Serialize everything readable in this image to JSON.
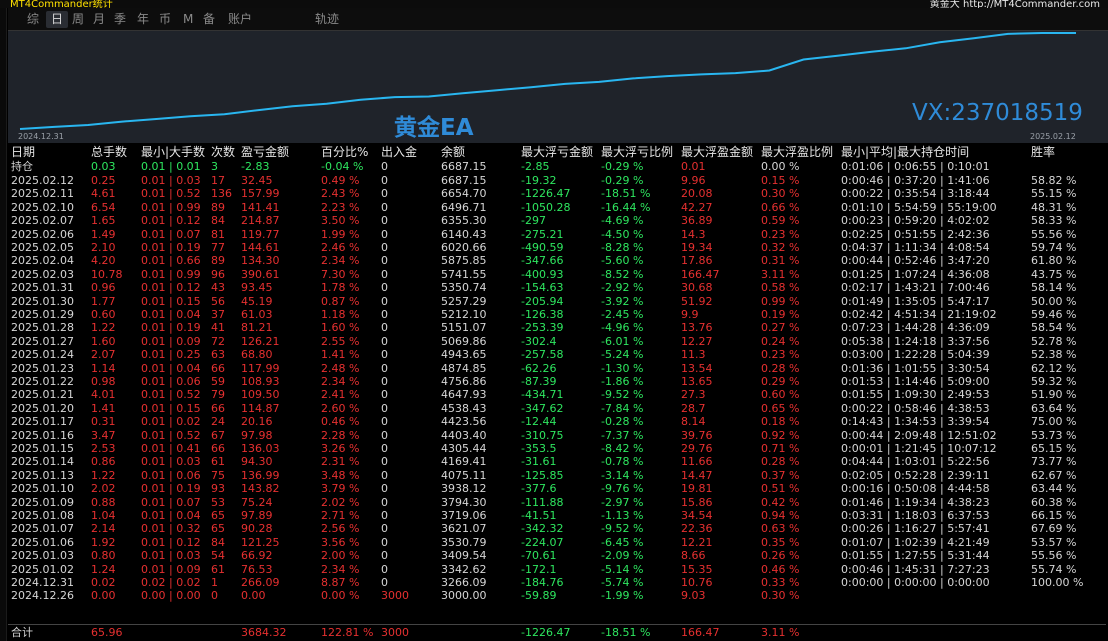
{
  "title_bar": {
    "left": "MT4Commander统计",
    "right": "黄金大 http://MT4Commander.com"
  },
  "tabs": [
    "综",
    "日",
    "周",
    "月",
    "季",
    "年",
    "币",
    "M",
    "备",
    "账户",
    "轨迹"
  ],
  "active_tab": 1,
  "chart": {
    "start_date": "2024.12.31",
    "end_date": "2025.02.12",
    "watermark_left": "黄金EA",
    "watermark_right": "VX:237018519",
    "curve_color": "#29b6f0"
  },
  "columns": [
    "日期",
    "总手数",
    "最小|大手数",
    "次数",
    "盈亏金额",
    "百分比%",
    "出入金",
    "余额",
    "最大浮亏金额",
    "最大浮亏比例",
    "最大浮盈金额",
    "最大浮盈比例",
    "最小|平均|最大持仓时间",
    "胜率"
  ],
  "position": [
    "持仓",
    "0.03",
    "0.01 | 0.01",
    "3",
    "-2.83",
    "-0.04 %",
    "0",
    "6687.15",
    "-2.85",
    "-0.29 %",
    "0.01",
    "0.00 %",
    "0:01:06 | 0:06:55 | 0:10:01",
    ""
  ],
  "rows": [
    [
      "2025.02.12",
      "0.25",
      "0.01 | 0.03",
      "17",
      "32.45",
      "0.49 %",
      "0",
      "6687.15",
      "-19.32",
      "-0.29 %",
      "9.96",
      "0.15 %",
      "0:00:46 | 0:37:20 | 1:41:06",
      "58.82 %"
    ],
    [
      "2025.02.11",
      "4.61",
      "0.01 | 0.52",
      "136",
      "157.99",
      "2.43 %",
      "0",
      "6654.70",
      "-1226.47",
      "-18.51 %",
      "20.08",
      "0.30 %",
      "0:00:22 | 0:35:54 | 3:18:44",
      "55.15 %"
    ],
    [
      "2025.02.10",
      "6.54",
      "0.01 | 0.99",
      "89",
      "141.41",
      "2.23 %",
      "0",
      "6496.71",
      "-1050.28",
      "-16.44 %",
      "42.27",
      "0.66 %",
      "0:01:10 | 5:54:59 | 55:19:00",
      "48.31 %"
    ],
    [
      "2025.02.07",
      "1.65",
      "0.01 | 0.12",
      "84",
      "214.87",
      "3.50 %",
      "0",
      "6355.30",
      "-297",
      "-4.69 %",
      "36.89",
      "0.59 %",
      "0:00:23 | 0:59:20 | 4:02:02",
      "58.33 %"
    ],
    [
      "2025.02.06",
      "1.49",
      "0.01 | 0.07",
      "81",
      "119.77",
      "1.99 %",
      "0",
      "6140.43",
      "-275.21",
      "-4.50 %",
      "14.3",
      "0.23 %",
      "0:02:25 | 0:51:55 | 2:42:36",
      "55.56 %"
    ],
    [
      "2025.02.05",
      "2.10",
      "0.01 | 0.19",
      "77",
      "144.61",
      "2.46 %",
      "0",
      "6020.66",
      "-490.59",
      "-8.28 %",
      "19.34",
      "0.32 %",
      "0:04:37 | 1:11:34 | 4:08:54",
      "59.74 %"
    ],
    [
      "2025.02.04",
      "4.20",
      "0.01 | 0.66",
      "89",
      "134.30",
      "2.34 %",
      "0",
      "5875.85",
      "-347.66",
      "-5.60 %",
      "17.86",
      "0.31 %",
      "0:00:44 | 0:52:46 | 3:47:20",
      "61.80 %"
    ],
    [
      "2025.02.03",
      "10.78",
      "0.01 | 0.99",
      "96",
      "390.61",
      "7.30 %",
      "0",
      "5741.55",
      "-400.93",
      "-8.52 %",
      "166.47",
      "3.11 %",
      "0:01:25 | 1:07:24 | 4:36:08",
      "43.75 %"
    ],
    [
      "2025.01.31",
      "0.96",
      "0.01 | 0.12",
      "43",
      "93.45",
      "1.78 %",
      "0",
      "5350.74",
      "-154.63",
      "-2.92 %",
      "30.68",
      "0.58 %",
      "0:02:17 | 1:43:21 | 7:00:46",
      "58.14 %"
    ],
    [
      "2025.01.30",
      "1.77",
      "0.01 | 0.15",
      "56",
      "45.19",
      "0.87 %",
      "0",
      "5257.29",
      "-205.94",
      "-3.92 %",
      "51.92",
      "0.99 %",
      "0:01:49 | 1:35:05 | 5:47:17",
      "50.00 %"
    ],
    [
      "2025.01.29",
      "0.60",
      "0.01 | 0.04",
      "37",
      "61.03",
      "1.18 %",
      "0",
      "5212.10",
      "-126.38",
      "-2.45 %",
      "9.9",
      "0.19 %",
      "0:02:42 | 4:51:34 | 21:19:02",
      "59.46 %"
    ],
    [
      "2025.01.28",
      "1.22",
      "0.01 | 0.19",
      "41",
      "81.21",
      "1.60 %",
      "0",
      "5151.07",
      "-253.39",
      "-4.96 %",
      "13.76",
      "0.27 %",
      "0:07:23 | 1:44:28 | 4:36:09",
      "58.54 %"
    ],
    [
      "2025.01.27",
      "1.60",
      "0.01 | 0.09",
      "72",
      "126.21",
      "2.55 %",
      "0",
      "5069.86",
      "-302.4",
      "-6.01 %",
      "12.27",
      "0.24 %",
      "0:05:38 | 1:24:18 | 3:37:56",
      "52.78 %"
    ],
    [
      "2025.01.24",
      "2.07",
      "0.01 | 0.25",
      "63",
      "68.80",
      "1.41 %",
      "0",
      "4943.65",
      "-257.58",
      "-5.24 %",
      "11.3",
      "0.23 %",
      "0:03:00 | 1:22:28 | 5:04:39",
      "52.38 %"
    ],
    [
      "2025.01.23",
      "1.14",
      "0.01 | 0.04",
      "66",
      "117.99",
      "2.48 %",
      "0",
      "4874.85",
      "-62.26",
      "-1.30 %",
      "13.54",
      "0.28 %",
      "0:01:36 | 1:01:55 | 3:30:54",
      "62.12 %"
    ],
    [
      "2025.01.22",
      "0.98",
      "0.01 | 0.06",
      "59",
      "108.93",
      "2.34 %",
      "0",
      "4756.86",
      "-87.39",
      "-1.86 %",
      "13.65",
      "0.29 %",
      "0:01:53 | 1:14:46 | 5:09:00",
      "59.32 %"
    ],
    [
      "2025.01.21",
      "4.01",
      "0.01 | 0.52",
      "79",
      "109.50",
      "2.41 %",
      "0",
      "4647.93",
      "-434.71",
      "-9.52 %",
      "27.3",
      "0.60 %",
      "0:01:55 | 1:09:30 | 2:49:53",
      "51.90 %"
    ],
    [
      "2025.01.20",
      "1.41",
      "0.01 | 0.15",
      "66",
      "114.87",
      "2.60 %",
      "0",
      "4538.43",
      "-347.62",
      "-7.84 %",
      "28.7",
      "0.65 %",
      "0:00:22 | 0:58:46 | 4:38:53",
      "63.64 %"
    ],
    [
      "2025.01.17",
      "0.31",
      "0.01 | 0.02",
      "24",
      "20.16",
      "0.46 %",
      "0",
      "4423.56",
      "-12.44",
      "-0.28 %",
      "8.14",
      "0.18 %",
      "0:14:43 | 1:34:53 | 3:39:54",
      "75.00 %"
    ],
    [
      "2025.01.16",
      "3.47",
      "0.01 | 0.52",
      "67",
      "97.98",
      "2.28 %",
      "0",
      "4403.40",
      "-310.75",
      "-7.37 %",
      "39.76",
      "0.92 %",
      "0:00:44 | 2:09:48 | 12:51:02",
      "53.73 %"
    ],
    [
      "2025.01.15",
      "2.53",
      "0.01 | 0.41",
      "66",
      "136.03",
      "3.26 %",
      "0",
      "4305.44",
      "-353.5",
      "-8.42 %",
      "29.76",
      "0.71 %",
      "0:00:01 | 1:21:45 | 10:07:12",
      "65.15 %"
    ],
    [
      "2025.01.14",
      "0.86",
      "0.01 | 0.03",
      "61",
      "94.30",
      "2.31 %",
      "0",
      "4169.41",
      "-31.61",
      "-0.78 %",
      "11.66",
      "0.28 %",
      "0:04:44 | 1:03:01 | 5:22:56",
      "73.77 %"
    ],
    [
      "2025.01.13",
      "1.22",
      "0.01 | 0.06",
      "75",
      "136.99",
      "3.48 %",
      "0",
      "4075.11",
      "-125.85",
      "-3.14 %",
      "14.47",
      "0.37 %",
      "0:02:05 | 0:52:28 | 2:39:11",
      "62.67 %"
    ],
    [
      "2025.01.10",
      "2.02",
      "0.01 | 0.19",
      "93",
      "143.82",
      "3.79 %",
      "0",
      "3938.12",
      "-377.6",
      "-9.76 %",
      "19.81",
      "0.51 %",
      "0:00:16 | 0:50:08 | 4:44:58",
      "63.44 %"
    ],
    [
      "2025.01.09",
      "0.88",
      "0.01 | 0.07",
      "53",
      "75.24",
      "2.02 %",
      "0",
      "3794.30",
      "-111.88",
      "-2.97 %",
      "15.86",
      "0.42 %",
      "0:01:46 | 1:19:34 | 4:38:23",
      "60.38 %"
    ],
    [
      "2025.01.08",
      "1.04",
      "0.01 | 0.04",
      "65",
      "97.89",
      "2.71 %",
      "0",
      "3719.06",
      "-41.51",
      "-1.13 %",
      "34.54",
      "0.94 %",
      "0:03:31 | 1:18:03 | 6:37:53",
      "66.15 %"
    ],
    [
      "2025.01.07",
      "2.14",
      "0.01 | 0.32",
      "65",
      "90.28",
      "2.56 %",
      "0",
      "3621.07",
      "-342.32",
      "-9.52 %",
      "22.36",
      "0.63 %",
      "0:00:26 | 1:16:27 | 5:57:41",
      "67.69 %"
    ],
    [
      "2025.01.06",
      "1.92",
      "0.01 | 0.12",
      "84",
      "121.25",
      "3.56 %",
      "0",
      "3530.79",
      "-224.07",
      "-6.45 %",
      "12.21",
      "0.35 %",
      "0:01:07 | 1:02:39 | 4:21:49",
      "53.57 %"
    ],
    [
      "2025.01.03",
      "0.80",
      "0.01 | 0.03",
      "54",
      "66.92",
      "2.00 %",
      "0",
      "3409.54",
      "-70.61",
      "-2.09 %",
      "8.66",
      "0.26 %",
      "0:01:55 | 1:27:55 | 5:31:44",
      "55.56 %"
    ],
    [
      "2025.01.02",
      "1.24",
      "0.01 | 0.09",
      "61",
      "76.53",
      "2.34 %",
      "0",
      "3342.62",
      "-172.1",
      "-5.14 %",
      "15.35",
      "0.46 %",
      "0:00:46 | 1:45:31 | 7:27:23",
      "55.74 %"
    ],
    [
      "2024.12.31",
      "0.02",
      "0.02 | 0.02",
      "1",
      "266.09",
      "8.87 %",
      "0",
      "3266.09",
      "-184.76",
      "-5.74 %",
      "10.76",
      "0.33 %",
      "0:00:00 | 0:00:00 | 0:00:00",
      "100.00 %"
    ],
    [
      "2024.12.26",
      "0.00",
      "0.00 | 0.00",
      "0",
      "0.00",
      "0.00 %",
      "3000",
      "3000.00",
      "-59.89",
      "-1.99 %",
      "9.03",
      "0.30 %",
      "",
      ""
    ]
  ],
  "total": [
    "合计",
    "65.96",
    "",
    "",
    "3684.32",
    "122.81 %",
    "3000",
    "",
    "-1226.47",
    "-18.51 %",
    "166.47",
    "3.11 %",
    "",
    ""
  ]
}
